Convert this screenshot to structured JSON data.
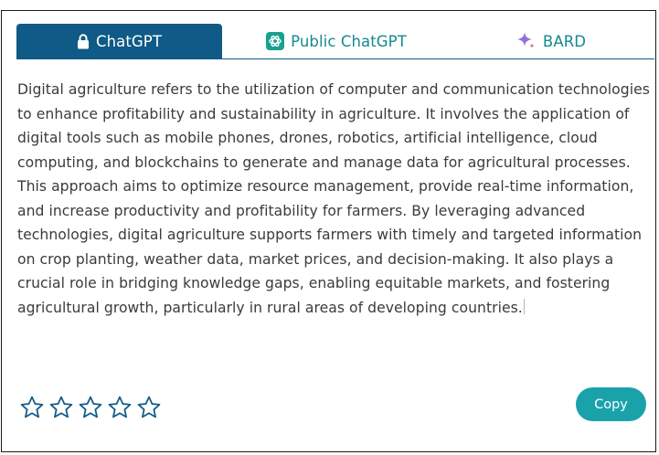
{
  "tabs": [
    {
      "label": "ChatGPT",
      "icon": "lock-icon",
      "active": true
    },
    {
      "label": "Public ChatGPT",
      "icon": "openai-logo-icon",
      "active": false
    },
    {
      "label": "BARD",
      "icon": "sparkle-icon",
      "active": false
    }
  ],
  "response": {
    "text": "Digital agriculture refers to the utilization of computer and communication technologies to enhance profitability and sustainability in agriculture. It involves the application of digital tools such as mobile phones, drones, robotics, artificial intelligence, cloud computing, and blockchains to generate and manage data for agricultural processes. This approach aims to optimize resource management, provide real-time information, and increase productivity and profitability for farmers. By leveraging advanced technologies, digital agriculture supports farmers with timely and targeted information on crop planting, weather data, market prices, and decision-making. It also plays a crucial role in bridging knowledge gaps, enabling equitable markets, and fostering agricultural growth, particularly in rural areas of developing countries."
  },
  "rating": {
    "max_stars": 5,
    "selected": 0
  },
  "actions": {
    "copy_label": "Copy"
  },
  "colors": {
    "active_tab": "#0f5a86",
    "tab_text": "#158a8f",
    "copy_button": "#1aa2ab",
    "star_outline": "#0f5a86",
    "body_text": "#3b3b3b"
  }
}
